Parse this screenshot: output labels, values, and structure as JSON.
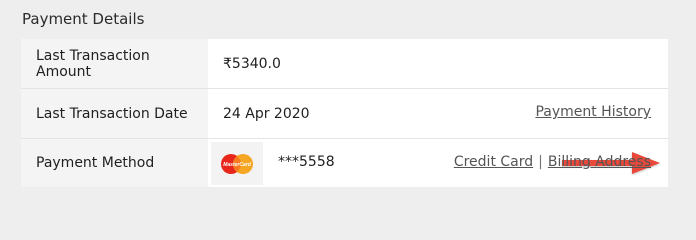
{
  "section": {
    "title": "Payment Details"
  },
  "rows": [
    {
      "label": "Last Transaction Amount",
      "value": "₹5340.0"
    },
    {
      "label": "Last Transaction Date",
      "value": "24 Apr 2020",
      "link": "Payment History"
    },
    {
      "label": "Payment Method",
      "masked_card": "***5558",
      "card_brand_text": "MasterCard",
      "links": [
        "Credit Card",
        "Billing Address"
      ],
      "separator": "|"
    }
  ],
  "icons": {
    "card_logo": "mastercard-logo-icon",
    "annotation": "red-arrow-icon"
  },
  "colors": {
    "arrow": "#e8493a",
    "link": "#555555",
    "label_bg": "#f4f4f4",
    "page_bg": "#eeeeee"
  }
}
